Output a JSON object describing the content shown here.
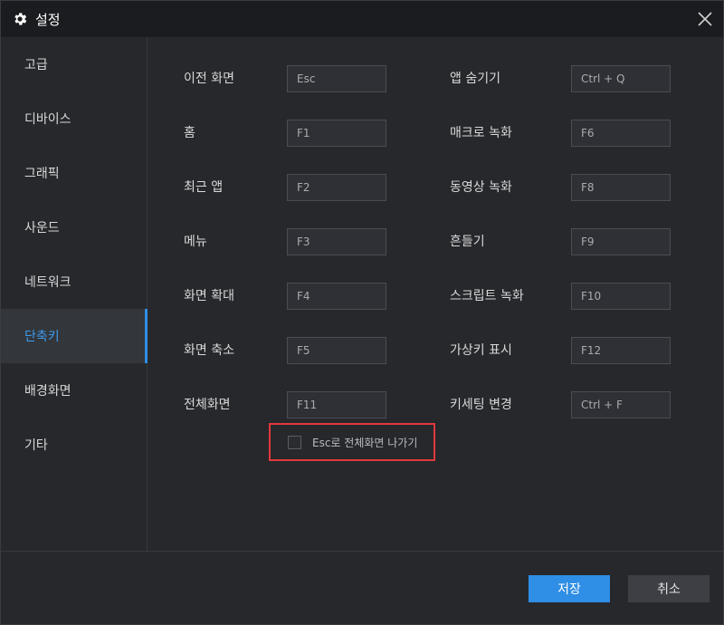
{
  "window": {
    "title": "설정"
  },
  "sidebar": {
    "items": [
      {
        "label": "고급"
      },
      {
        "label": "디바이스"
      },
      {
        "label": "그래픽"
      },
      {
        "label": "사운드"
      },
      {
        "label": "네트워크"
      },
      {
        "label": "단축키",
        "active": true
      },
      {
        "label": "배경화면"
      },
      {
        "label": "기타"
      }
    ]
  },
  "shortcuts": {
    "left": [
      {
        "label": "이전 화면",
        "key": "Esc"
      },
      {
        "label": "홈",
        "key": "F1"
      },
      {
        "label": "최근 앱",
        "key": "F2"
      },
      {
        "label": "메뉴",
        "key": "F3"
      },
      {
        "label": "화면 확대",
        "key": "F4"
      },
      {
        "label": "화면 축소",
        "key": "F5"
      },
      {
        "label": "전체화면",
        "key": "F11"
      }
    ],
    "right": [
      {
        "label": "앱 숨기기",
        "key": "Ctrl + Q"
      },
      {
        "label": "매크로 녹화",
        "key": "F6"
      },
      {
        "label": "동영상 녹화",
        "key": "F8"
      },
      {
        "label": "흔들기",
        "key": "F9"
      },
      {
        "label": "스크립트 녹화",
        "key": "F10"
      },
      {
        "label": "가상키 표시",
        "key": "F12"
      },
      {
        "label": "키세팅 변경",
        "key": "Ctrl + F"
      }
    ]
  },
  "fullscreen_exit": {
    "label": "Esc로 전체화면 나가기",
    "checked": false
  },
  "footer": {
    "save_label": "저장",
    "cancel_label": "취소"
  },
  "colors": {
    "accent": "#2f8ee5",
    "highlight_border": "#e0393c",
    "background": "#26282c"
  },
  "icons": {
    "title": "gear-icon",
    "close": "close-icon"
  }
}
